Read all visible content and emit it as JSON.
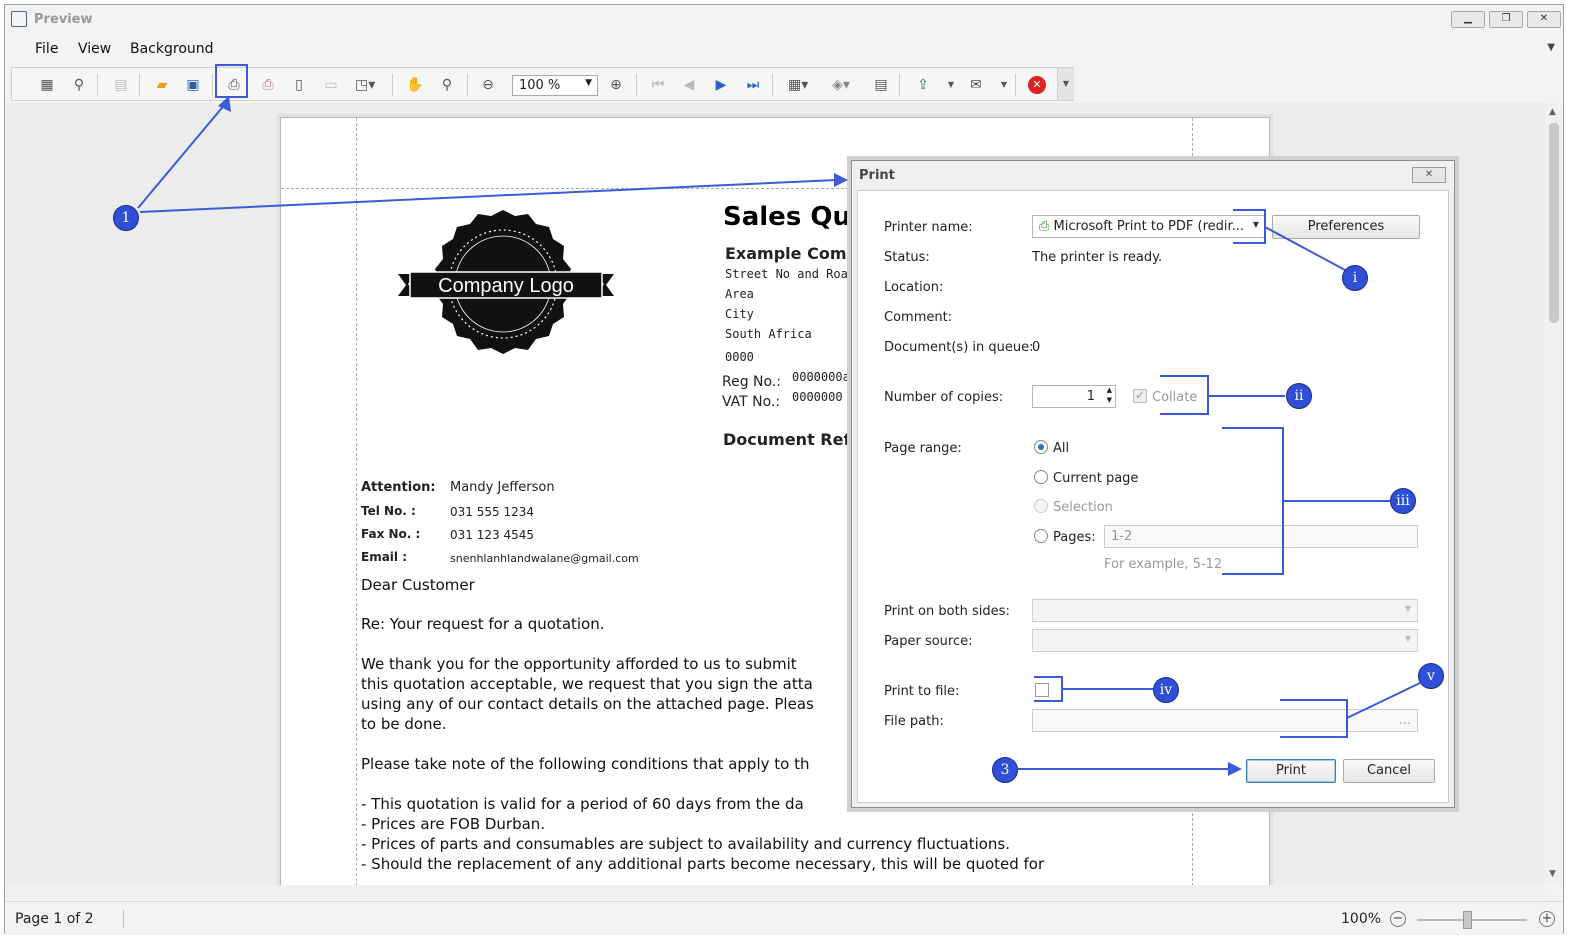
{
  "window": {
    "title": "Preview"
  },
  "menu": {
    "file": "File",
    "view": "View",
    "background": "Background"
  },
  "toolbar": {
    "zoom_value": "100 %"
  },
  "document": {
    "logo_text": "Company Logo",
    "title": "Sales Qu",
    "company_name": "Example Comp",
    "address": [
      "Street No and Road N",
      "Area",
      "City",
      "South Africa",
      "0000"
    ],
    "reg_label": "Reg No.:",
    "reg_value": "0000000a",
    "vat_label": "VAT No.:",
    "vat_value": "0000000",
    "doc_ref": "Document Ref",
    "contact": [
      {
        "label": "Attention:",
        "value": "Mandy Jefferson"
      },
      {
        "label": "Tel No. :",
        "value": "031 555 1234"
      },
      {
        "label": "Fax No. :",
        "value": "031 123 4545"
      },
      {
        "label": "Email :",
        "value": "snenhlanhlandwalane@gmail.com"
      }
    ],
    "greeting": "Dear Customer",
    "re_line": "Re: Your request for a quotation.",
    "para1": [
      "We thank you for the opportunity afforded to us to submit",
      "this quotation acceptable, we request that you sign the atta",
      "using any of our contact details on the attached page. Pleas",
      "to be done."
    ],
    "para2": "Please take note of the following conditions that apply to th",
    "conditions": [
      "- This quotation is valid for a period of 60 days from the da",
      "- Prices are FOB Durban.",
      "- Prices of parts and consumables are subject to availability and currency fluctuations.",
      "- Should the replacement of any additional parts become necessary, this will be quoted for"
    ]
  },
  "status": {
    "page_info": "Page 1 of 2",
    "zoom": "100%"
  },
  "print_dialog": {
    "title": "Print",
    "printer_name_label": "Printer name:",
    "printer_name_value": "Microsoft Print to PDF (redir...",
    "preferences_label": "Preferences",
    "status_label": "Status:",
    "status_value": "The printer is ready.",
    "location_label": "Location:",
    "comment_label": "Comment:",
    "queue_label": "Document(s) in queue:",
    "queue_value": "0",
    "copies_label": "Number of copies:",
    "copies_value": "1",
    "collate_label": "Collate",
    "page_range_label": "Page range:",
    "range_all": "All",
    "range_current": "Current page",
    "range_selection": "Selection",
    "range_pages": "Pages:",
    "pages_value": "1-2",
    "pages_example": "For example, 5-12",
    "both_sides_label": "Print on both sides:",
    "paper_source_label": "Paper source:",
    "print_to_file_label": "Print to file:",
    "file_path_label": "File path:",
    "file_path_browse": "...",
    "print_button": "Print",
    "cancel_button": "Cancel"
  },
  "annotations": {
    "c1": "1",
    "ci": "i",
    "cii": "ii",
    "ciii": "iii",
    "civ": "iv",
    "cv": "v",
    "c3": "3"
  },
  "colors": {
    "annotation": "#3a5bd9",
    "callout_fill": "#2f4fd7"
  }
}
